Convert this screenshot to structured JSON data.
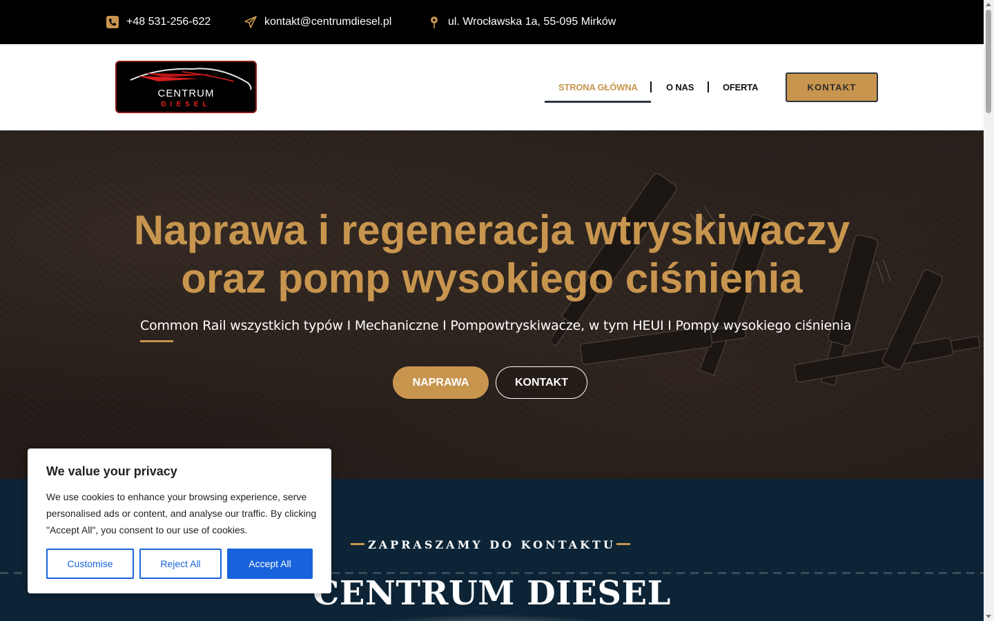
{
  "topbar": {
    "phone": "+48 531-256-622",
    "email": "kontakt@centrumdiesel.pl",
    "address": "ul. Wrocławska 1a, 55-095 Mirków"
  },
  "logo": {
    "line1": "CENTRUM",
    "line2": "DIESEL"
  },
  "nav": {
    "items": [
      {
        "label": "STRONA GŁÓWNA",
        "active": true
      },
      {
        "label": "O NAS",
        "active": false
      },
      {
        "label": "OFERTA",
        "active": false
      }
    ],
    "cta": "KONTAKT"
  },
  "hero": {
    "title_line1": "Naprawa i regeneracja wtryskiwaczy",
    "title_line2": "oraz pomp wysokiego ciśnienia",
    "subtitle": "Common Rail wszystkich typów I Mechaniczne I Pompowtryskiwacze, w tym HEUI I Pompy wysokiego ciśnienia",
    "btn_primary": "NAPRAWA",
    "btn_secondary": "KONTAKT"
  },
  "section": {
    "kicker": "ZAPRASZAMY DO KONTAKTU",
    "heading": "CENTRUM DIESEL"
  },
  "cookie": {
    "title": "We value your privacy",
    "text": "We use cookies to enhance your browsing experience, serve personalised ads or content, and analyse our traffic. By clicking \"Accept All\", you consent to our use of cookies.",
    "customise": "Customise",
    "reject": "Reject All",
    "accept": "Accept All"
  },
  "colors": {
    "accent": "#c8954f",
    "topbar_bg": "#000000",
    "section_bg": "#0c2436",
    "cookie_blue": "#1863dc"
  },
  "icons": [
    "phone-icon",
    "paper-plane-icon",
    "map-pin-icon"
  ]
}
